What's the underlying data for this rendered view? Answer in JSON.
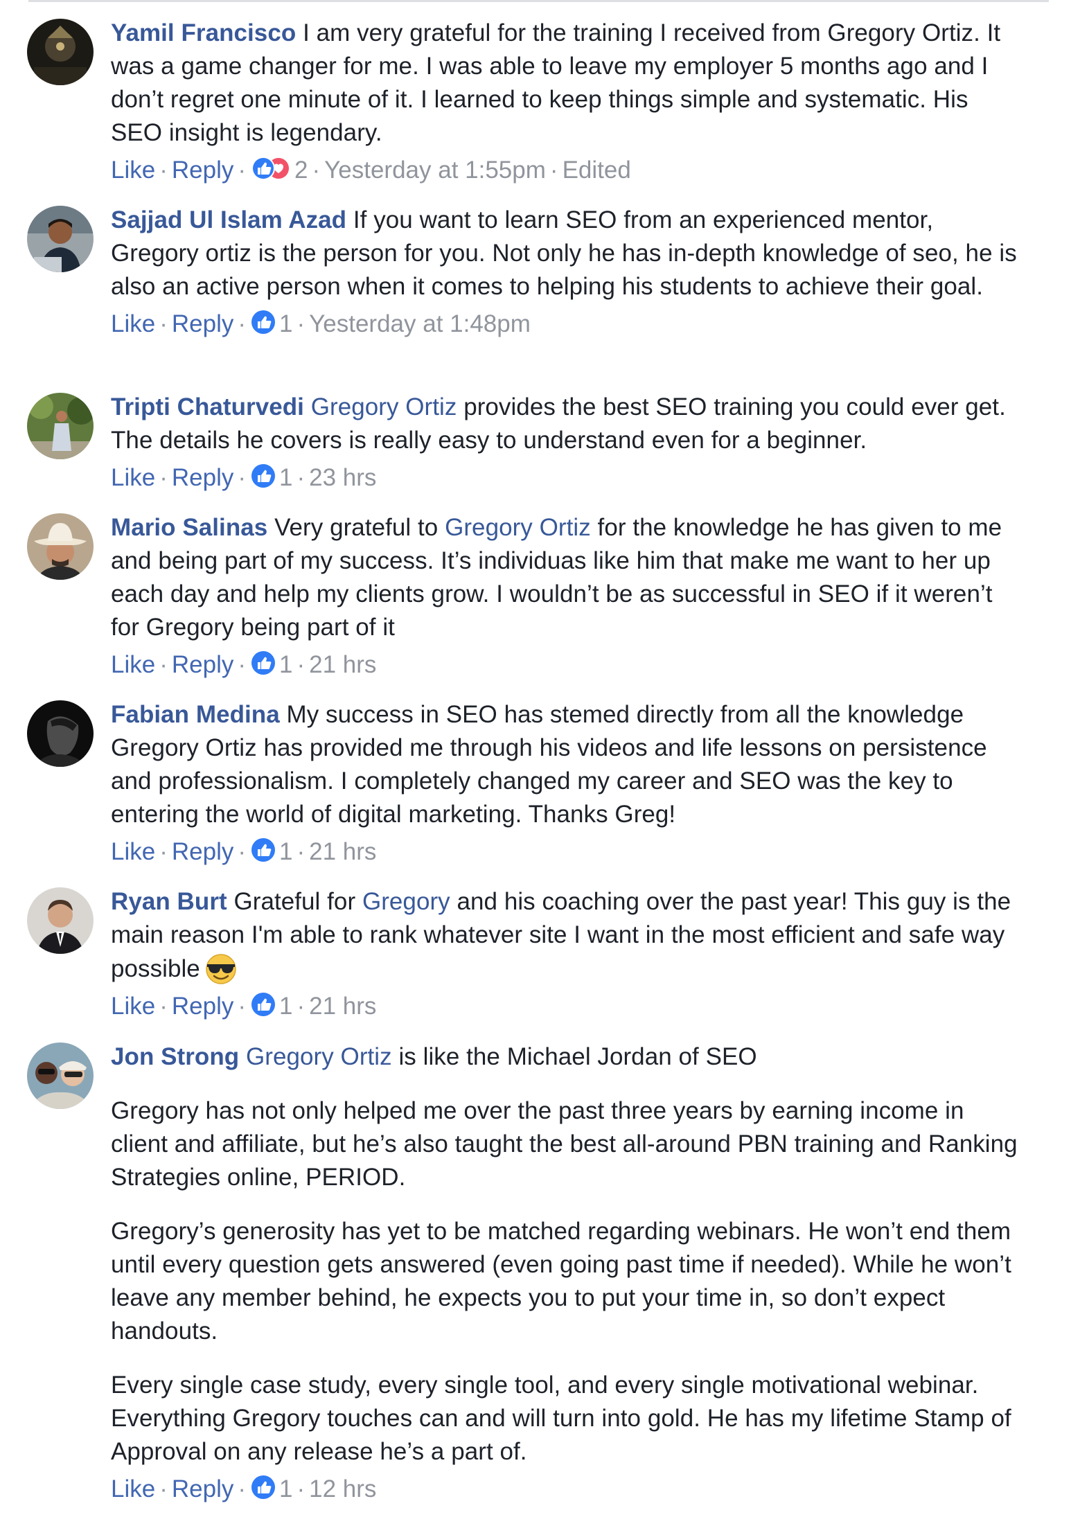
{
  "sep": "·",
  "comments": [
    {
      "author": "Yamil Francisco",
      "avatar": "avatar-dark-background",
      "text": "I am very grateful for the training I received from Gregory Ortiz. It was a game changer for me. I was able to leave my employer 5 months ago and I don’t regret one minute of it. I learned to keep things simple and systematic. His SEO insight is legendary.",
      "like_label": "Like",
      "reply_label": "Reply",
      "reactions": [
        "like-icon",
        "love-icon"
      ],
      "reaction_count": "2",
      "time": "Yesterday at 1:55pm",
      "edited": "Edited"
    },
    {
      "author": "Sajjad Ul Islam Azad",
      "avatar": "avatar-man-laptop",
      "text": "If you want to learn SEO from an experienced mentor, Gregory ortiz is the person for you. Not only he has in-depth knowledge of seo, he is also an active person when it comes to helping his students to achieve their goal.",
      "like_label": "Like",
      "reply_label": "Reply",
      "reactions": [
        "like-icon"
      ],
      "reaction_count": "1",
      "time": "Yesterday at 1:48pm"
    },
    {
      "author": "Tripti Chaturvedi",
      "avatar": "avatar-woman-garden",
      "mention": "Gregory Ortiz",
      "text": "provides the best SEO training you could ever get. The details he covers is really easy to understand even for a beginner.",
      "like_label": "Like",
      "reply_label": "Reply",
      "reactions": [
        "like-icon"
      ],
      "reaction_count": "1",
      "time": "23 hrs"
    },
    {
      "author": "Mario Salinas",
      "avatar": "avatar-cowboy-hat",
      "pre": "Very grateful to",
      "mention": "Gregory Ortiz",
      "text": "for the knowledge he has given to me and being part of my success. It’s individuas like him that make me want to her up each day and help my clients grow. I wouldn’t be as successful in SEO if it weren’t for Gregory being part of it",
      "like_label": "Like",
      "reply_label": "Reply",
      "reactions": [
        "like-icon"
      ],
      "reaction_count": "1",
      "time": "21 hrs"
    },
    {
      "author": "Fabian Medina",
      "avatar": "avatar-bw-portrait",
      "text": "My success in SEO has stemed directly from all the knowledge Gregory Ortiz has provided me through his videos and life lessons on persistence and professionalism. I completely changed my career and SEO was the key to entering the world of digital marketing. Thanks Greg!",
      "like_label": "Like",
      "reply_label": "Reply",
      "reactions": [
        "like-icon"
      ],
      "reaction_count": "1",
      "time": "21 hrs"
    },
    {
      "author": "Ryan Burt",
      "avatar": "avatar-man-suit",
      "pre": "Grateful for",
      "mention": "Gregory",
      "text": "and his coaching over the past year! This guy is the main reason I'm able to rank whatever site I want in the most efficient and safe way possible",
      "emoji": "sunglasses-emoji",
      "like_label": "Like",
      "reply_label": "Reply",
      "reactions": [
        "like-icon"
      ],
      "reaction_count": "1",
      "time": "21 hrs"
    },
    {
      "author": "Jon Strong",
      "avatar": "avatar-group-selfie",
      "mention": "Gregory Ortiz",
      "text": "is like the Michael Jordan of SEO",
      "paragraphs": [
        "Gregory has not only helped me over the past three years by earning income in client and affiliate, but he’s also taught the best all-around PBN training and Ranking Strategies online, PERIOD.",
        "Gregory’s generosity has yet to be matched regarding webinars. He won’t end them until every question gets answered (even going past time if needed). While he won’t leave any member behind, he expects you to put your time in, so don’t expect handouts.",
        "Every single case study, every single tool, and every single motivational webinar. Everything Gregory touches can and will turn into gold. He has my lifetime Stamp of Approval on any release he’s a part of."
      ],
      "like_label": "Like",
      "reply_label": "Reply",
      "reactions": [
        "like-icon"
      ],
      "reaction_count": "1",
      "time": "12 hrs"
    }
  ],
  "colors": {
    "name": "#385898",
    "action": "#4267b2",
    "meta": "#90949c",
    "text": "#1d2129",
    "like": "#2f7cf6",
    "love": "#f25268"
  }
}
